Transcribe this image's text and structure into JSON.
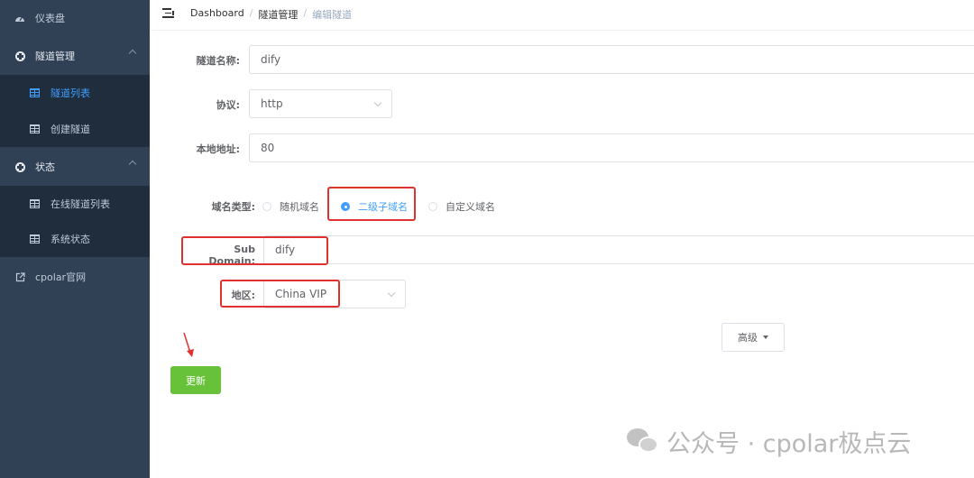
{
  "sidebar": {
    "items": [
      {
        "label": "仪表盘",
        "icon": "dashboard-icon"
      },
      {
        "label": "隧道管理",
        "icon": "plus-circle-icon"
      },
      {
        "label": "隧道列表",
        "icon": "table-icon",
        "active": true
      },
      {
        "label": "创建隧道",
        "icon": "table-icon"
      },
      {
        "label": "状态",
        "icon": "plus-circle-icon"
      },
      {
        "label": "在线隧道列表",
        "icon": "table-icon"
      },
      {
        "label": "系统状态",
        "icon": "table-icon"
      },
      {
        "label": "cpolar官网",
        "icon": "external-link-icon"
      }
    ]
  },
  "breadcrumb": [
    "Dashboard",
    "隧道管理",
    "编辑隧道"
  ],
  "breadcrumb_sep": "/",
  "form": {
    "name_label": "隧道名称:",
    "name_value": "dify",
    "protocol_label": "协议:",
    "protocol_value": "http",
    "local_addr_label": "本地地址:",
    "local_addr_value": "80",
    "domain_type_label": "域名类型:",
    "domain_options": [
      "随机域名",
      "二级子域名",
      "自定义域名"
    ],
    "domain_selected": "二级子域名",
    "subdomain_label": "Sub Domain:",
    "subdomain_value": "dify",
    "region_label": "地区:",
    "region_value": "China VIP",
    "advanced_label": "高级",
    "update_label": "更新"
  },
  "watermark": "公众号 · cpolar极点云",
  "colors": {
    "sidebar_bg": "#304156",
    "accent": "#409eff",
    "success": "#67c23a",
    "highlight": "#e03131"
  }
}
